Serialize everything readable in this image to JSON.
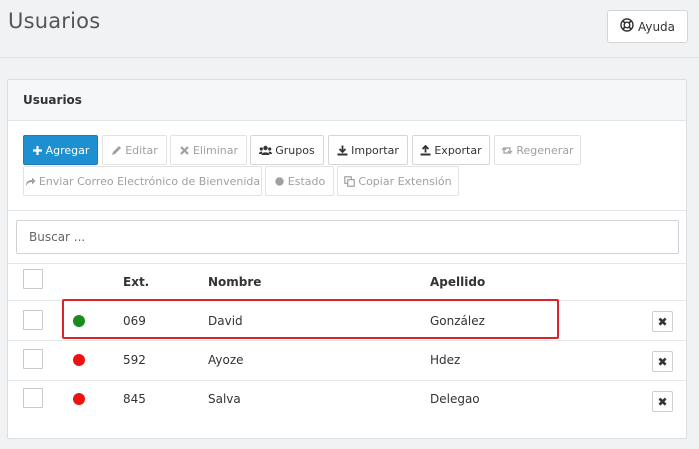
{
  "page": {
    "title": "Usuarios"
  },
  "help": {
    "label": "Ayuda"
  },
  "panel": {
    "title": "Usuarios"
  },
  "toolbar": {
    "add": "Agregar",
    "edit": "Editar",
    "delete": "Eliminar",
    "groups": "Grupos",
    "import": "Importar",
    "export": "Exportar",
    "regenerate": "Regenerar",
    "welcome_email": "Enviar Correo Electrónico de Bienvenida",
    "status": "Estado",
    "copy_extension": "Copiar Extensión"
  },
  "search": {
    "placeholder": "Buscar ..."
  },
  "table": {
    "headers": {
      "ext": "Ext.",
      "name": "Nombre",
      "surname": "Apellido"
    },
    "rows": [
      {
        "status_color": "#1a8a1a",
        "ext": "069",
        "name": "David",
        "surname": "González",
        "delete": "✖"
      },
      {
        "status_color": "#ee1111",
        "ext": "592",
        "name": "Ayoze",
        "surname": "Hdez",
        "delete": "✖"
      },
      {
        "status_color": "#ee1111",
        "ext": "845",
        "name": "Salva",
        "surname": "Delegao",
        "delete": "✖"
      }
    ]
  },
  "colors": {
    "primary": "#1e8fd1",
    "online": "#1a8a1a",
    "offline": "#ee1111",
    "highlight": "#e0202a"
  }
}
